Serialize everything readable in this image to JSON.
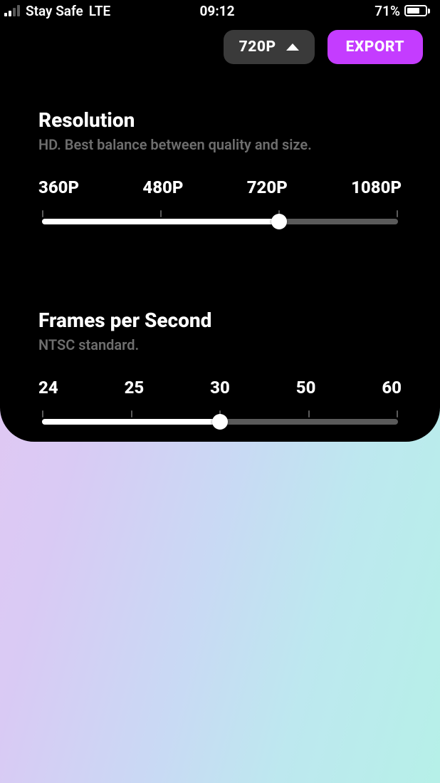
{
  "status_bar": {
    "carrier": "Stay Safe",
    "network": "LTE",
    "time": "09:12",
    "battery_percent_label": "71%",
    "battery_fraction": 0.71,
    "signal_active_bars": 2
  },
  "top_controls": {
    "resolution_pill_label": "720P",
    "export_label": "EXPORT"
  },
  "resolution": {
    "title": "Resolution",
    "subtitle": "HD. Best balance between quality and size.",
    "options": [
      "360P",
      "480P",
      "720P",
      "1080P"
    ],
    "selected_index": 2
  },
  "fps": {
    "title": "Frames per Second",
    "subtitle": "NTSC standard.",
    "options": [
      "24",
      "25",
      "30",
      "50",
      "60"
    ],
    "selected_index": 2
  },
  "colors": {
    "accent": "#c43cff",
    "panel": "#000000"
  }
}
